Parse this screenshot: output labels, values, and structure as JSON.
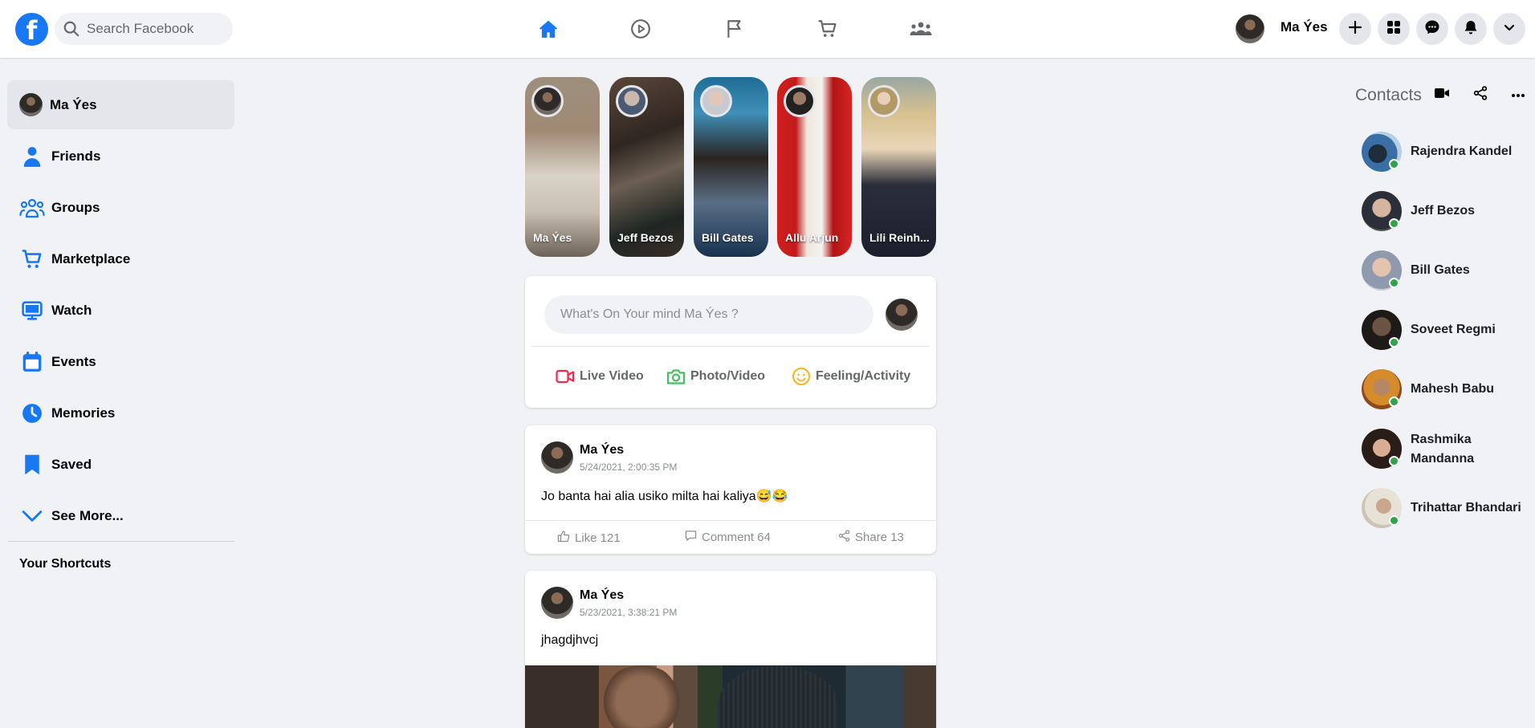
{
  "header": {
    "logo": "f",
    "search_placeholder": "Search Facebook",
    "nav_icons": [
      "home-icon",
      "watch-icon",
      "pages-flag-icon",
      "marketplace-cart-icon",
      "groups-icon"
    ],
    "user_name": "Ma Ýes",
    "action_icons": [
      "plus-icon",
      "menu-grid-icon",
      "messenger-icon",
      "bell-icon",
      "chevron-down-icon"
    ],
    "accent": "#1877f2"
  },
  "sidebar": {
    "profile_name": "Ma Ýes",
    "items": [
      {
        "label": "Friends",
        "icon": "friends-icon"
      },
      {
        "label": "Groups",
        "icon": "groups-icon"
      },
      {
        "label": "Marketplace",
        "icon": "marketplace-icon"
      },
      {
        "label": "Watch",
        "icon": "watch-monitor-icon"
      },
      {
        "label": "Events",
        "icon": "calendar-icon"
      },
      {
        "label": "Memories",
        "icon": "clock-icon"
      },
      {
        "label": "Saved",
        "icon": "bookmark-icon"
      },
      {
        "label": "See More...",
        "icon": "chevron-down-icon"
      }
    ],
    "shortcuts_title": "Your Shortcuts"
  },
  "stories": [
    {
      "name": "Ma Ýes"
    },
    {
      "name": "Jeff Bezos"
    },
    {
      "name": "Bill Gates"
    },
    {
      "name": "Allu Arjun"
    },
    {
      "name": "Lili Reinh..."
    }
  ],
  "composer": {
    "placeholder": "What's On Your mind Ma Ýes ?",
    "actions": [
      {
        "label": "Live Video",
        "icon": "video-camera-icon",
        "color": "#f02849"
      },
      {
        "label": "Photo/Video",
        "icon": "photo-camera-icon",
        "color": "#45bd62"
      },
      {
        "label": "Feeling/Activity",
        "icon": "smiley-icon",
        "color": "#f7b928"
      }
    ]
  },
  "posts": [
    {
      "author": "Ma Ýes",
      "timestamp": "5/24/2021, 2:00:35 PM",
      "text": "Jo banta hai alia usiko milta hai kaliya😅😂",
      "like": "Like 121",
      "comment": "Comment 64",
      "share": "Share 13"
    },
    {
      "author": "Ma Ýes",
      "timestamp": "5/23/2021, 3:38:21 PM",
      "text": "jhagdjhvcj"
    }
  ],
  "contacts": {
    "title": "Contacts",
    "header_icons": [
      "video-call-icon",
      "share-icon",
      "more-icon"
    ],
    "list": [
      {
        "name": "Rajendra Kandel"
      },
      {
        "name": "Jeff Bezos"
      },
      {
        "name": "Bill Gates"
      },
      {
        "name": "Soveet Regmi"
      },
      {
        "name": "Mahesh Babu"
      },
      {
        "name": "Rashmika Mandanna"
      },
      {
        "name": "Trihattar Bhandari"
      }
    ]
  }
}
